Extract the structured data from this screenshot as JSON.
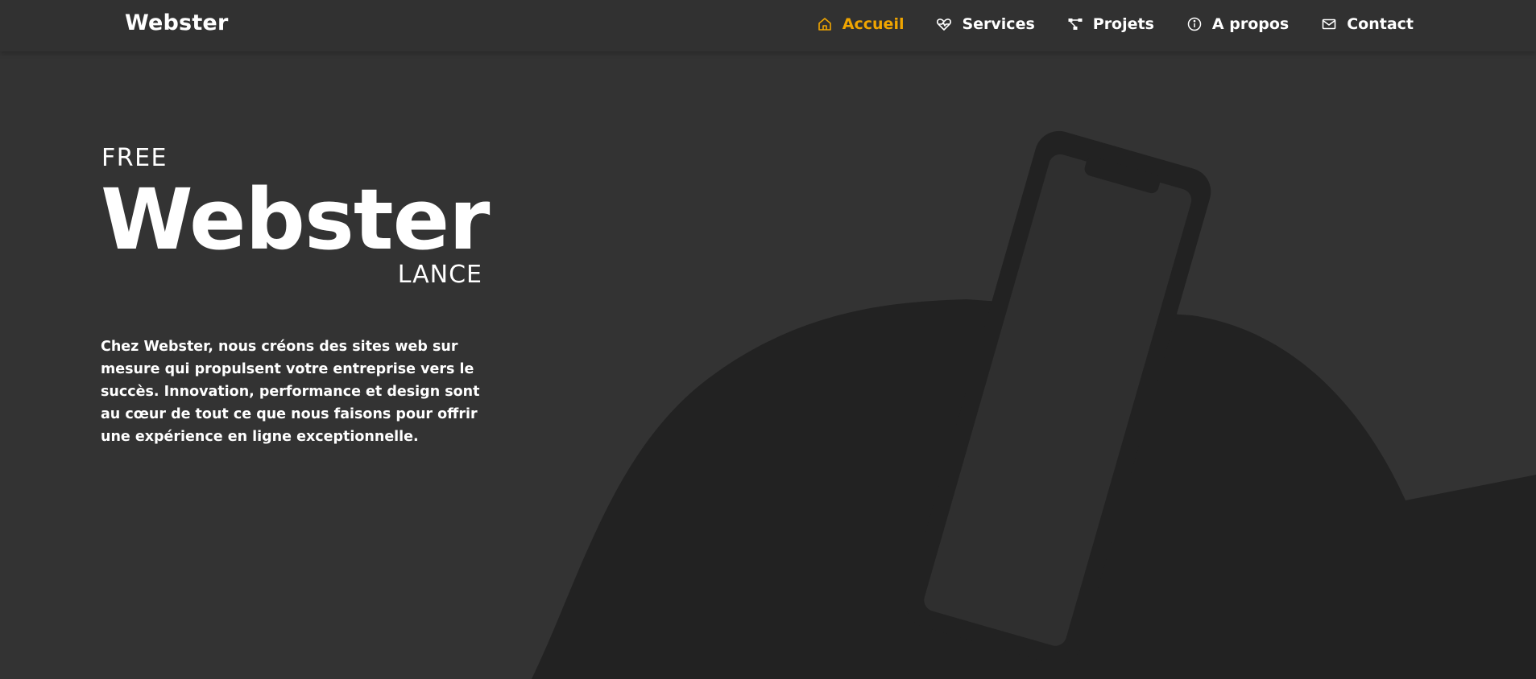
{
  "brand": "Webster",
  "nav": {
    "items": [
      {
        "label": "Accueil",
        "icon": "home-icon",
        "active": true
      },
      {
        "label": "Services",
        "icon": "heart-pulse-icon",
        "active": false
      },
      {
        "label": "Projets",
        "icon": "project-diagram-icon",
        "active": false
      },
      {
        "label": "A propos",
        "icon": "info-icon",
        "active": false
      },
      {
        "label": "Contact",
        "icon": "mail-icon",
        "active": false
      }
    ]
  },
  "hero": {
    "kicker": "FREE",
    "title": "Webster",
    "suffix": "LANCE",
    "description": "Chez Webster, nous créons des sites web sur mesure qui propulsent votre entreprise vers le succès. Innovation, performance et design sont au cœur de tout ce que nous faisons pour offrir une expérience en ligne exceptionnelle."
  },
  "colors": {
    "background": "#333333",
    "header": "#313131",
    "accent": "#f0a500",
    "illustration_dark": "#222222",
    "illustration_mid": "#2f2f2f",
    "text": "#ffffff"
  }
}
